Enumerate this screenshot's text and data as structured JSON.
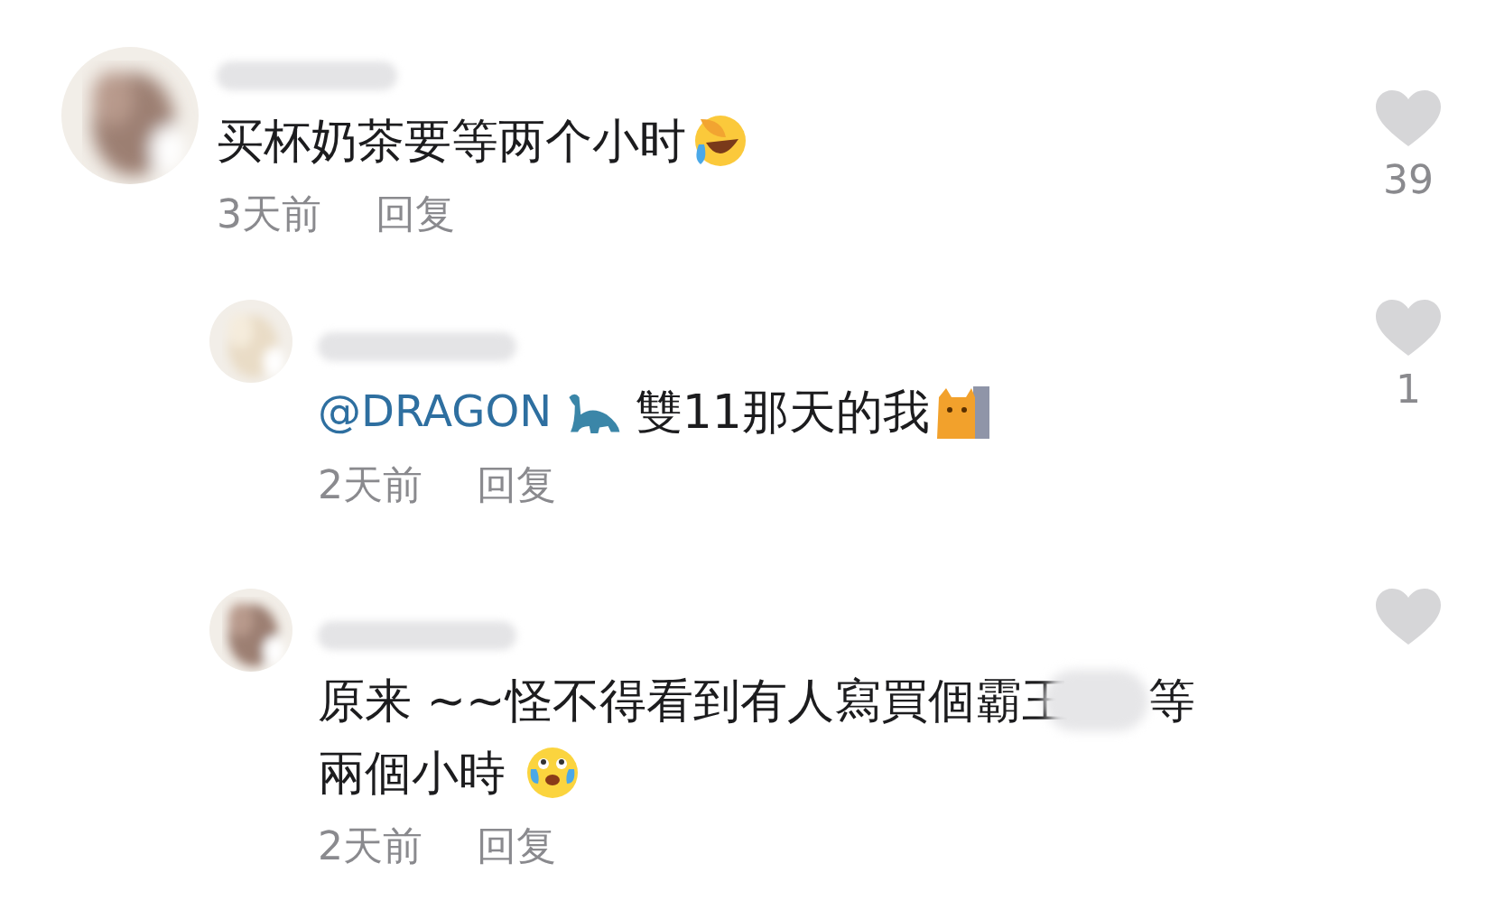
{
  "comments": [
    {
      "kind": "top",
      "avatar": {
        "kind": "picture"
      },
      "lines": [
        [
          {
            "kind": "text",
            "text": "买杯奶茶要等两个小时"
          },
          {
            "kind": "laughing"
          }
        ]
      ],
      "time": "3天前",
      "reply": "回复",
      "likes": "39"
    },
    {
      "kind": "reply",
      "avatar": {
        "kind": "picture"
      },
      "lines": [
        [
          {
            "kind": "mention",
            "text": "@DRAGON"
          },
          {
            "kind": "dinosaur"
          },
          {
            "kind": "text",
            "text": " 雙11那天的我"
          },
          {
            "kind": "cat"
          }
        ]
      ],
      "time": "2天前",
      "reply": "回复",
      "likes": "1"
    },
    {
      "kind": "reply",
      "avatar": {
        "kind": "picture"
      },
      "lines": [
        [
          {
            "kind": "text",
            "text": "原来 ~~怪不得看到有人寫買個霸王"
          },
          {
            "kind": "blur"
          },
          {
            "kind": "text",
            "text": "等"
          }
        ],
        [
          {
            "kind": "text",
            "text": "兩個小時 "
          },
          {
            "kind": "crying"
          }
        ]
      ],
      "time": "2天前",
      "reply": "回复"
    }
  ]
}
